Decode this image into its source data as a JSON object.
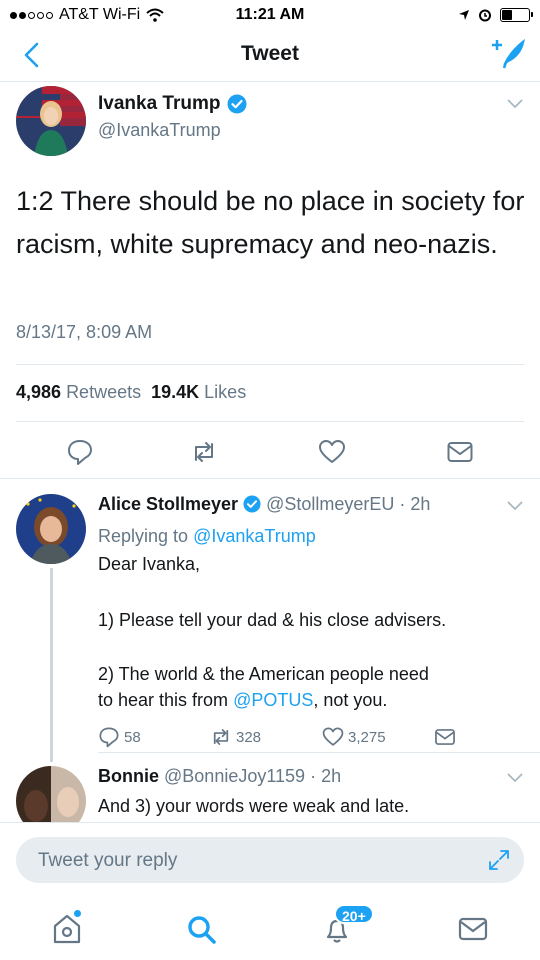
{
  "status_bar": {
    "carrier": "AT&T Wi-Fi",
    "time": "11:21 AM",
    "battery_level": 0.35
  },
  "nav": {
    "title": "Tweet",
    "back_icon": "chevron-left-icon",
    "compose_icon": "compose-icon"
  },
  "tweet": {
    "author_name": "Ivanka Trump",
    "handle": "@IvankaTrump",
    "text": "1:2 There should be no place in society for racism, white supremacy and neo-nazis.",
    "timestamp": "8/13/17, 8:09 AM",
    "retweets_count": "4,986",
    "retweets_label": "Retweets",
    "likes_count": "19.4K",
    "likes_label": "Likes"
  },
  "replies": [
    {
      "name": "Alice Stollmeyer",
      "handle": "@StollmeyerEU",
      "age": "2h",
      "replying_prefix": "Replying to",
      "replying_to": "@IvankaTrump",
      "line1": "Dear Ivanka,",
      "line2": "1) Please tell your dad & his close advisers.",
      "line3_a": "2) The world & the American people need",
      "line3_b": "to hear this from",
      "line3_mention": "@POTUS",
      "line3_c": ", not you.",
      "reply_count": "58",
      "retweet_count": "328",
      "like_count": "3,275"
    },
    {
      "name": "Bonnie",
      "handle": "@BonnieJoy1159",
      "age": "2h",
      "text": "And 3) your words were weak and late."
    }
  ],
  "composer": {
    "placeholder": "Tweet your reply"
  },
  "tab_bar": {
    "notifications_badge": "20+"
  },
  "colors": {
    "accent": "#1da1f2",
    "muted": "#657786",
    "text": "#14171a",
    "divider": "#e1e8ed"
  }
}
